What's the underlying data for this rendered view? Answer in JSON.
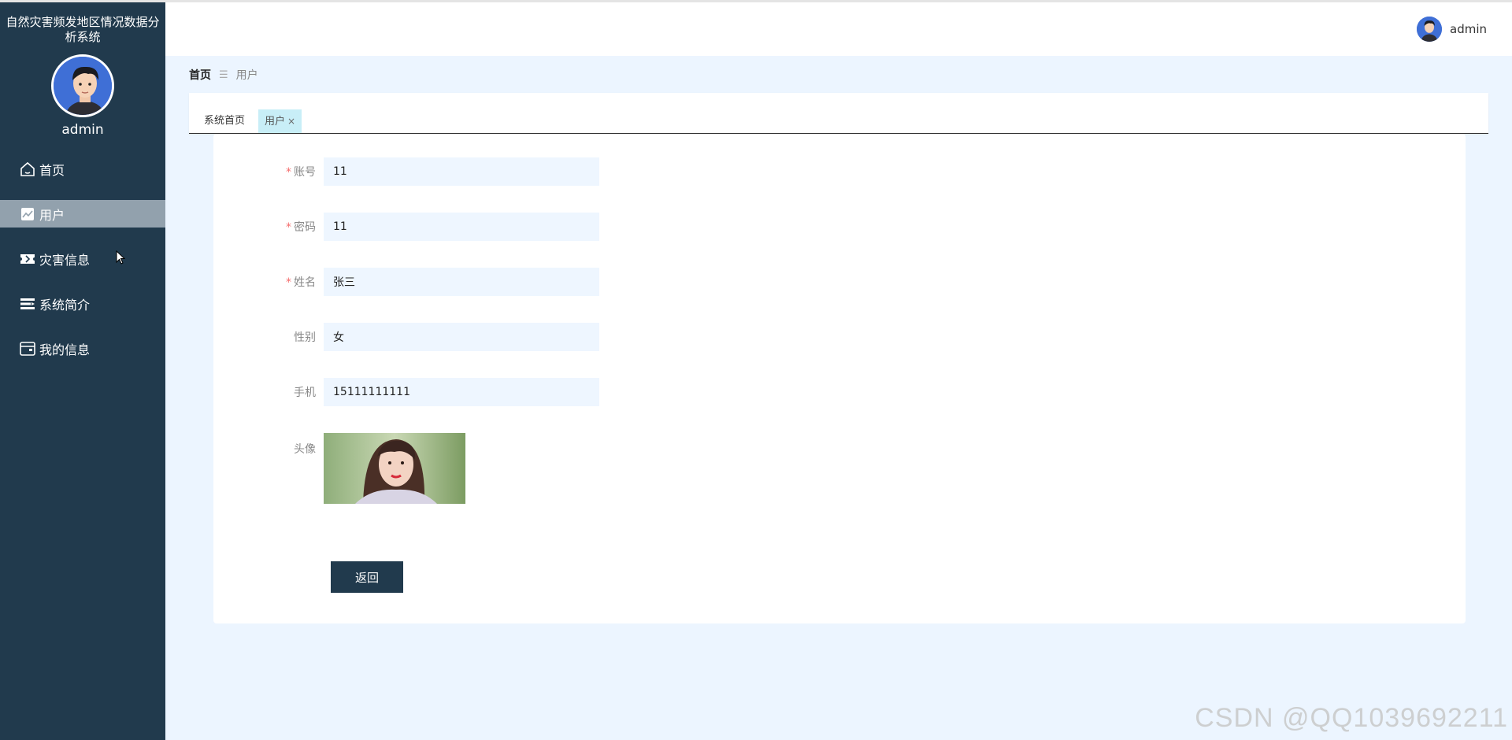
{
  "app": {
    "title": "自然灾害频发地区情况数据分析系统"
  },
  "sidebar": {
    "username": "admin",
    "items": [
      {
        "label": "首页",
        "icon": "home-icon"
      },
      {
        "label": "用户",
        "icon": "chart-icon",
        "active": true
      },
      {
        "label": "灾害信息",
        "icon": "ticket-icon"
      },
      {
        "label": "系统简介",
        "icon": "list-icon"
      },
      {
        "label": "我的信息",
        "icon": "wallet-icon"
      }
    ]
  },
  "header": {
    "username": "admin"
  },
  "breadcrumb": {
    "home": "首页",
    "current": "用户"
  },
  "tabs": [
    {
      "label": "系统首页"
    },
    {
      "label": "用户",
      "close": "×",
      "active": true
    }
  ],
  "form": {
    "account": {
      "label": "账号",
      "value": "11",
      "required": true
    },
    "password": {
      "label": "密码",
      "value": "11",
      "required": true
    },
    "name": {
      "label": "姓名",
      "value": "张三",
      "required": true
    },
    "gender": {
      "label": "性别",
      "value": "女"
    },
    "phone": {
      "label": "手机",
      "value": "15111111111"
    },
    "avatar": {
      "label": "头像"
    },
    "back_label": "返回",
    "required_mark": "*"
  },
  "watermark": "CSDN @QQ1039692211",
  "colors": {
    "sidebar": "#213a4d",
    "active_menu": "#92a1ad",
    "background": "#ecf5ff",
    "active_tab": "#c8eef7",
    "required": "#f56c6c"
  }
}
